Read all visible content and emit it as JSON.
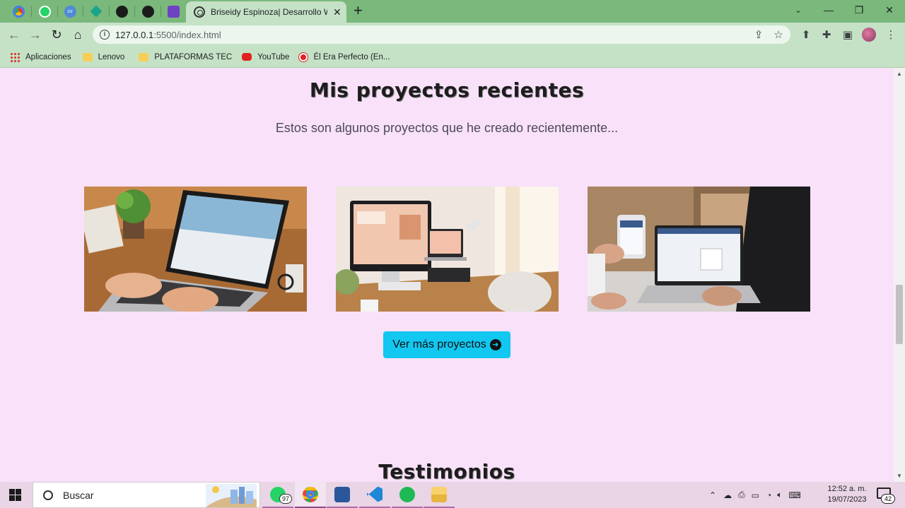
{
  "browser": {
    "active_tab_title": "Briseidy Espinoza| Desarrollo Web",
    "close_glyph": "✕",
    "new_tab_glyph": "+",
    "url_host": "127.0.0.1",
    "url_rest": ":5500/index.html",
    "window_controls": {
      "minimize": "—",
      "restore": "❐",
      "close": "✕"
    },
    "bookmarks": [
      {
        "label": "Aplicaciones",
        "icon": "apps-grid-icon"
      },
      {
        "label": "Lenovo",
        "icon": "folder-icon"
      },
      {
        "label": "PLATAFORMAS TEC",
        "icon": "folder-icon"
      },
      {
        "label": "YouTube",
        "icon": "youtube-icon"
      },
      {
        "label": "Él Era Perfecto (En...",
        "icon": "radio-icon"
      }
    ]
  },
  "page": {
    "projects_heading": "Mis proyectos recientes",
    "projects_subtitle": "Estos son algunos proyectos que he creado recientemente...",
    "projects": [
      {
        "name": "laptop-web-design-photo"
      },
      {
        "name": "imac-desk-photo"
      },
      {
        "name": "phone-laptop-photo"
      }
    ],
    "more_button": "Ver más proyectos",
    "more_button_arrow": "➜",
    "testimonials_heading": "Testimonios",
    "accent_color": "#12c7f0",
    "background_color": "#f9e1f9"
  },
  "taskbar": {
    "search_placeholder": "Buscar",
    "whatsapp_badge": "97",
    "time": "12:52 a. m.",
    "date": "19/07/2023",
    "notification_count": "42"
  }
}
